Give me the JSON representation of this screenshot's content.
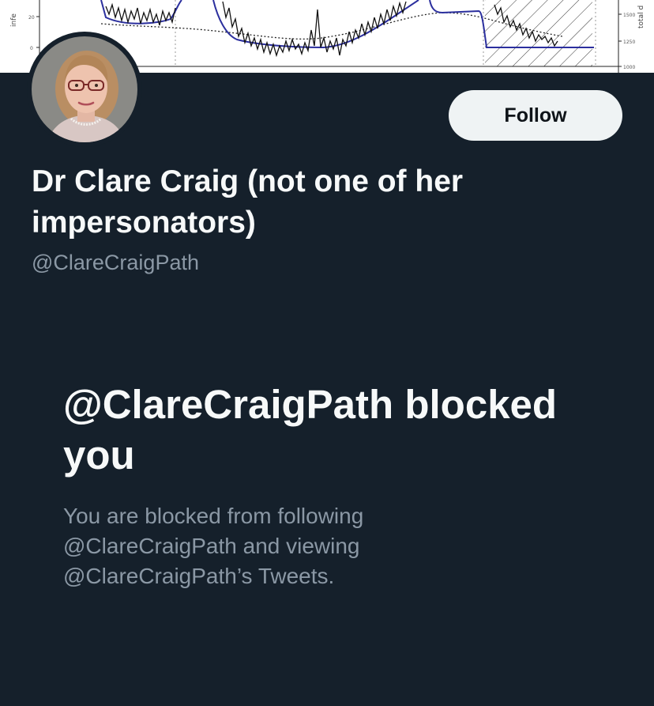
{
  "banner": {
    "left_axis_label": "infe",
    "left_ticks": [
      "20",
      "0"
    ],
    "right_axis_label": "total d",
    "right_ticks": [
      "1500",
      "1250",
      "1000"
    ],
    "colors": {
      "trend_line": "#2b2f9e",
      "noisy_line": "#111111",
      "hatch": "#333333"
    }
  },
  "profile": {
    "avatar": "profile-photo",
    "follow_label": "Follow",
    "display_name": "Dr Clare Craig (not one of her impersonators)",
    "handle": "@ClareCraigPath"
  },
  "blocked": {
    "title": "@ClareCraigPath blocked you",
    "message": "You are blocked from following @ClareCraigPath and viewing @ClareCraigPath’s Tweets."
  },
  "theme": {
    "background": "#15202b",
    "primary_text": "#f7f9f9",
    "secondary_text": "#8b98a5",
    "button_bg": "#eff3f4",
    "button_text": "#0f1419"
  }
}
